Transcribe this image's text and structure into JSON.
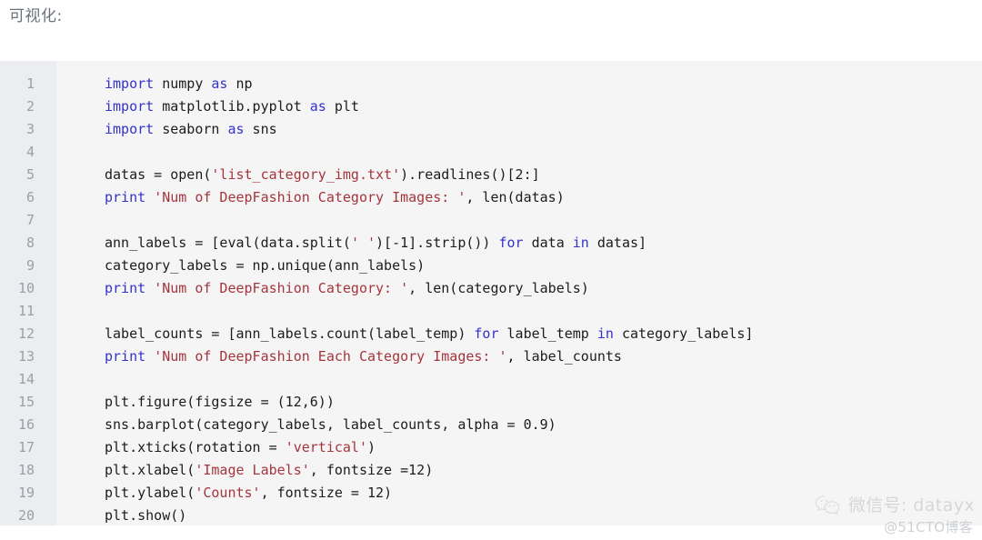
{
  "page": {
    "heading": "可视化:",
    "background_color": "#ffffff"
  },
  "code_block": {
    "background_color": "#f5f5f6",
    "gutter_color": "#ecedf0",
    "language": "python",
    "colors": {
      "keyword": "#3333cc",
      "string": "#a5353c",
      "plain": "#1c1c1c",
      "line_number": "#9aa0a6"
    },
    "line_numbers": [
      "1",
      "2",
      "3",
      "4",
      "5",
      "6",
      "7",
      "8",
      "9",
      "10",
      "11",
      "12",
      "13",
      "14",
      "15",
      "16",
      "17",
      "18",
      "19",
      "20"
    ],
    "lines": [
      {
        "n": "1",
        "tokens": [
          {
            "t": "import",
            "c": "kw"
          },
          {
            "t": " numpy ",
            "c": "pl"
          },
          {
            "t": "as",
            "c": "kw"
          },
          {
            "t": " np",
            "c": "pl"
          }
        ]
      },
      {
        "n": "2",
        "tokens": [
          {
            "t": "import",
            "c": "kw"
          },
          {
            "t": " matplotlib.pyplot ",
            "c": "pl"
          },
          {
            "t": "as",
            "c": "kw"
          },
          {
            "t": " plt",
            "c": "pl"
          }
        ]
      },
      {
        "n": "3",
        "tokens": [
          {
            "t": "import",
            "c": "kw"
          },
          {
            "t": " seaborn ",
            "c": "pl"
          },
          {
            "t": "as",
            "c": "kw"
          },
          {
            "t": " sns",
            "c": "pl"
          }
        ]
      },
      {
        "n": "4",
        "tokens": []
      },
      {
        "n": "5",
        "tokens": [
          {
            "t": "datas = open(",
            "c": "pl"
          },
          {
            "t": "'list_category_img.txt'",
            "c": "str"
          },
          {
            "t": ").readlines()[2:]",
            "c": "pl"
          }
        ]
      },
      {
        "n": "6",
        "tokens": [
          {
            "t": "print",
            "c": "kw"
          },
          {
            "t": " ",
            "c": "pl"
          },
          {
            "t": "'Num of DeepFashion Category Images: '",
            "c": "str"
          },
          {
            "t": ", len(datas)",
            "c": "pl"
          }
        ]
      },
      {
        "n": "7",
        "tokens": []
      },
      {
        "n": "8",
        "tokens": [
          {
            "t": "ann_labels = [eval(data.split(",
            "c": "pl"
          },
          {
            "t": "' '",
            "c": "str"
          },
          {
            "t": ")[-1].strip()) ",
            "c": "pl"
          },
          {
            "t": "for",
            "c": "kw"
          },
          {
            "t": " data ",
            "c": "pl"
          },
          {
            "t": "in",
            "c": "kw"
          },
          {
            "t": " datas]",
            "c": "pl"
          }
        ]
      },
      {
        "n": "9",
        "tokens": [
          {
            "t": "category_labels = np.unique(ann_labels)",
            "c": "pl"
          }
        ]
      },
      {
        "n": "10",
        "tokens": [
          {
            "t": "print",
            "c": "kw"
          },
          {
            "t": " ",
            "c": "pl"
          },
          {
            "t": "'Num of DeepFashion Category: '",
            "c": "str"
          },
          {
            "t": ", len(category_labels)",
            "c": "pl"
          }
        ]
      },
      {
        "n": "11",
        "tokens": []
      },
      {
        "n": "12",
        "tokens": [
          {
            "t": "label_counts = [ann_labels.count(label_temp) ",
            "c": "pl"
          },
          {
            "t": "for",
            "c": "kw"
          },
          {
            "t": " label_temp ",
            "c": "pl"
          },
          {
            "t": "in",
            "c": "kw"
          },
          {
            "t": " category_labels]",
            "c": "pl"
          }
        ]
      },
      {
        "n": "13",
        "tokens": [
          {
            "t": "print",
            "c": "kw"
          },
          {
            "t": " ",
            "c": "pl"
          },
          {
            "t": "'Num of DeepFashion Each Category Images: '",
            "c": "str"
          },
          {
            "t": ", label_counts",
            "c": "pl"
          }
        ]
      },
      {
        "n": "14",
        "tokens": []
      },
      {
        "n": "15",
        "tokens": [
          {
            "t": "plt.figure(figsize = (12,6))",
            "c": "pl"
          }
        ]
      },
      {
        "n": "16",
        "tokens": [
          {
            "t": "sns.barplot(category_labels, label_counts, alpha = 0.9)",
            "c": "pl"
          }
        ]
      },
      {
        "n": "17",
        "tokens": [
          {
            "t": "plt.xticks(rotation = ",
            "c": "pl"
          },
          {
            "t": "'vertical'",
            "c": "str"
          },
          {
            "t": ")",
            "c": "pl"
          }
        ]
      },
      {
        "n": "18",
        "tokens": [
          {
            "t": "plt.xlabel(",
            "c": "pl"
          },
          {
            "t": "'Image Labels'",
            "c": "str"
          },
          {
            "t": ", fontsize =12)",
            "c": "pl"
          }
        ]
      },
      {
        "n": "19",
        "tokens": [
          {
            "t": "plt.ylabel(",
            "c": "pl"
          },
          {
            "t": "'Counts'",
            "c": "str"
          },
          {
            "t": ", fontsize = 12)",
            "c": "pl"
          }
        ]
      },
      {
        "n": "20",
        "tokens": [
          {
            "t": "plt.show()",
            "c": "pl"
          }
        ]
      }
    ]
  },
  "watermark": {
    "icon": "wechat-icon",
    "label": "微信号: datayx",
    "source": "@51CTO博客"
  }
}
